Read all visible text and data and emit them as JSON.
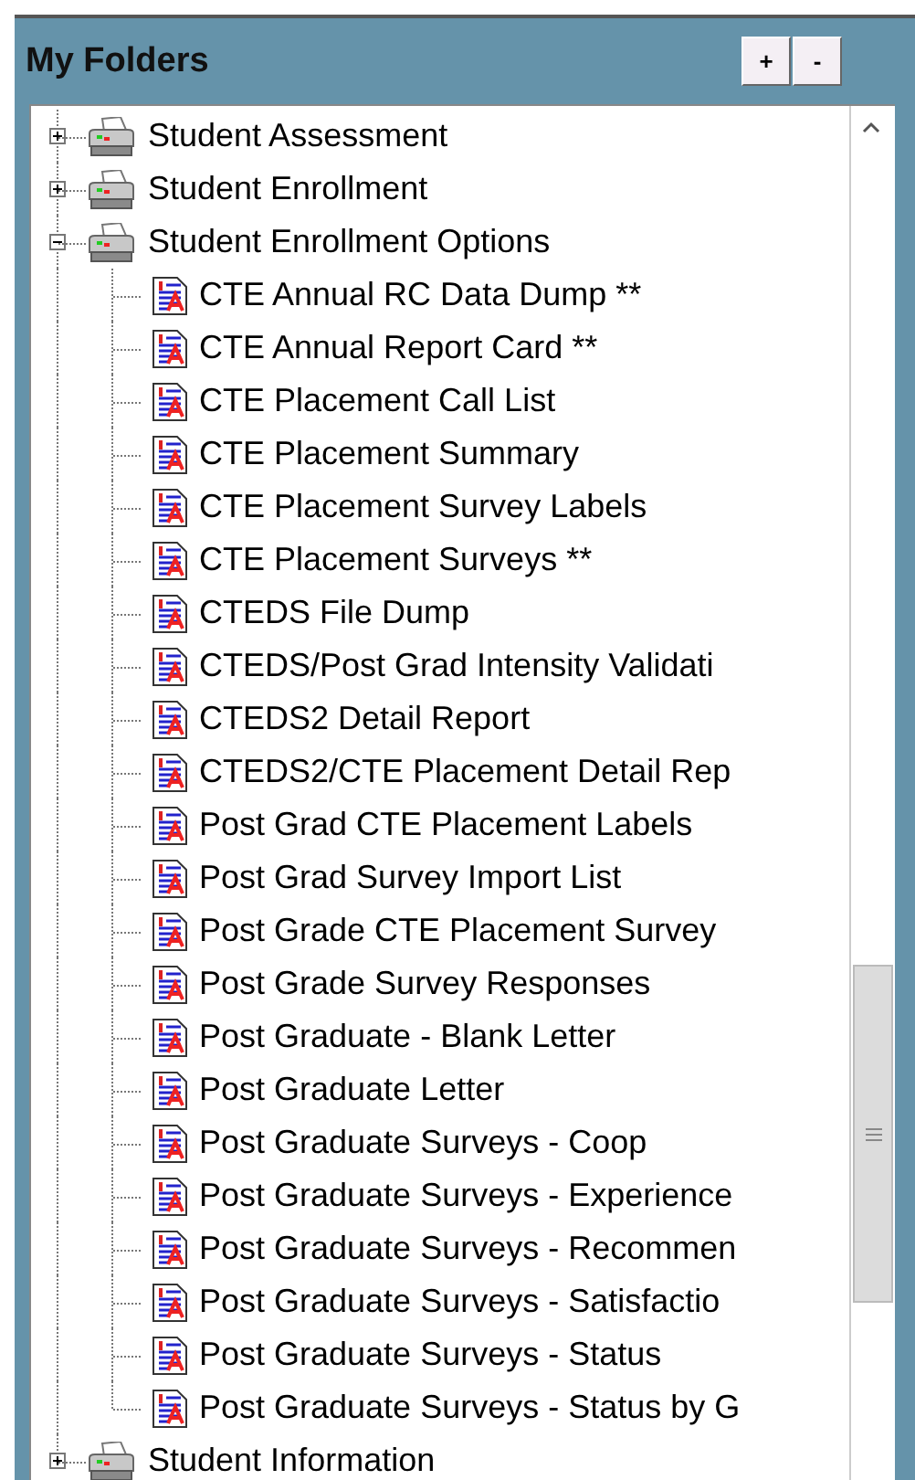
{
  "panel": {
    "title": "My Folders",
    "buttons": [
      "+",
      "-"
    ]
  },
  "tree": [
    {
      "label": "Student Assessment",
      "expanded": false
    },
    {
      "label": "Student Enrollment",
      "expanded": false
    },
    {
      "label": "Student Enrollment Options",
      "expanded": true,
      "children": [
        {
          "label": "CTE Annual RC Data Dump **"
        },
        {
          "label": "CTE Annual Report Card **"
        },
        {
          "label": "CTE Placement Call List"
        },
        {
          "label": "CTE Placement Summary"
        },
        {
          "label": "CTE Placement Survey Labels"
        },
        {
          "label": "CTE Placement Surveys **"
        },
        {
          "label": "CTEDS File Dump"
        },
        {
          "label": "CTEDS/Post Grad Intensity Validati"
        },
        {
          "label": "CTEDS2 Detail Report"
        },
        {
          "label": "CTEDS2/CTE Placement Detail Rep"
        },
        {
          "label": "Post Grad CTE Placement Labels"
        },
        {
          "label": "Post Grad Survey Import List"
        },
        {
          "label": "Post Grade CTE Placement Survey"
        },
        {
          "label": "Post Grade Survey Responses"
        },
        {
          "label": "Post Graduate - Blank Letter"
        },
        {
          "label": "Post Graduate Letter"
        },
        {
          "label": "Post Graduate Surveys - Coop"
        },
        {
          "label": "Post Graduate Surveys - Experience"
        },
        {
          "label": "Post Graduate Surveys - Recommen"
        },
        {
          "label": "Post Graduate Surveys - Satisfactio"
        },
        {
          "label": "Post Graduate Surveys - Status"
        },
        {
          "label": "Post Graduate Surveys - Status by G"
        }
      ]
    },
    {
      "label": "Student Information",
      "expanded": false
    }
  ]
}
